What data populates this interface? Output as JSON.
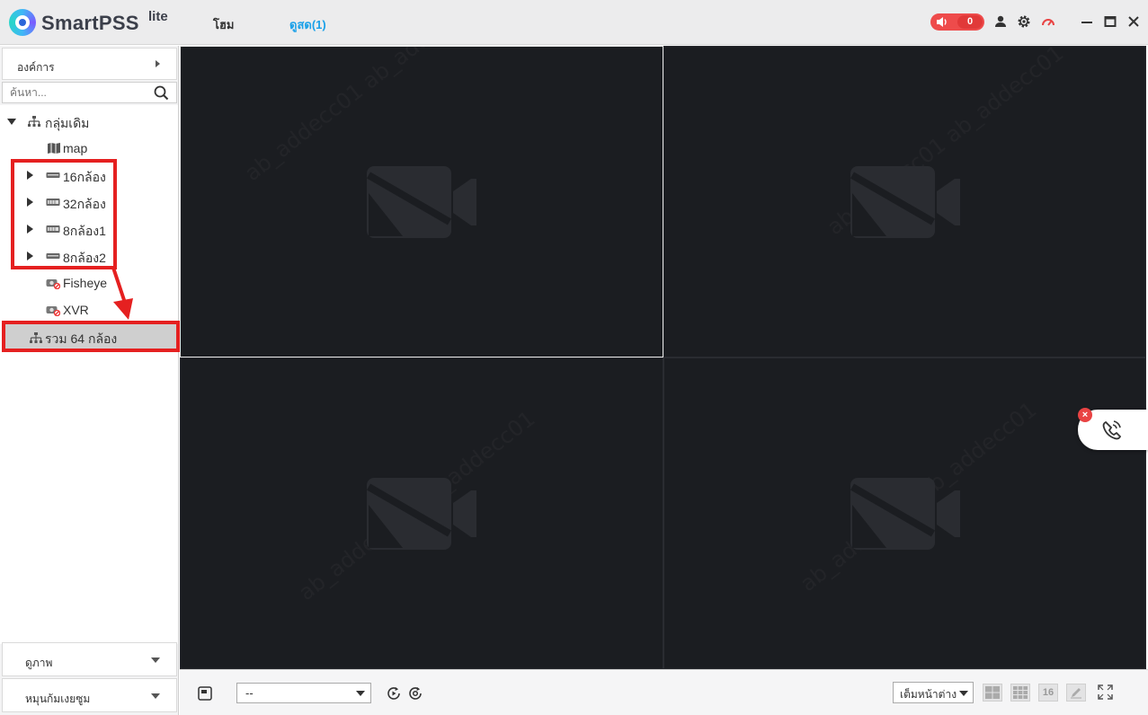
{
  "app": {
    "name": "SmartPSS",
    "name_suffix": "lite",
    "tabs": [
      {
        "label": "โฮม"
      },
      {
        "label": "ดูสด(1)"
      }
    ],
    "alarm_count": "0"
  },
  "sidebar": {
    "org_label": "องค์การ",
    "search_placeholder": "ค้นหา...",
    "tree": {
      "root": "กลุ่มเดิม",
      "items": [
        {
          "label": "map",
          "icon": "map-icon"
        },
        {
          "label": "16กล้อง",
          "icon": "nvr-icon"
        },
        {
          "label": "32กล้อง",
          "icon": "nvr-icon"
        },
        {
          "label": "8กล้อง1",
          "icon": "dvr-icon"
        },
        {
          "label": "8กล้อง2",
          "icon": "nvr-icon"
        },
        {
          "label": "Fisheye",
          "icon": "offline-camera-icon"
        },
        {
          "label": "XVR",
          "icon": "offline-camera-icon"
        }
      ],
      "group": "รวม 64 กล้อง"
    },
    "view_label": "ดูภาพ",
    "ptz_label": "หมุนก้มเงยซูม"
  },
  "toolbar": {
    "view_select_value": "--",
    "fit_select_value": "เต็มหน้าต่าง",
    "layout_16_label": "16"
  },
  "colors": {
    "accent": "#1aa0e8",
    "alarm": "#ee4b4b",
    "highlight": "#e52020",
    "video_bg": "#1b1d21"
  }
}
